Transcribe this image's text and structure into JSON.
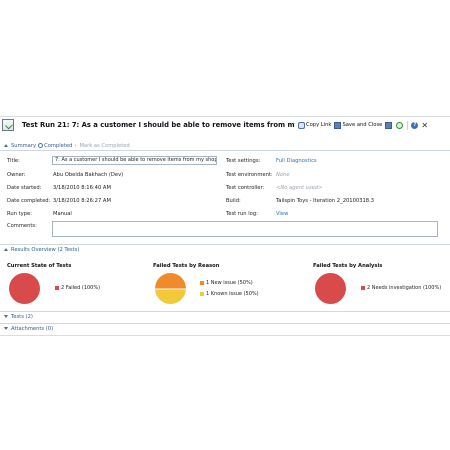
{
  "window": {
    "title": "Test Run 21: 7: As a customer I should be able to remove items from my shopping",
    "toolbar": {
      "copy_link": "Copy Link",
      "save_close": "Save and Close",
      "help": "?",
      "close": "✕"
    }
  },
  "summary_bar": {
    "summary": "Summary",
    "completed": "Completed",
    "mark_completed": "Mark as Completed"
  },
  "form": {
    "title_label": "Title:",
    "title_value": "7: As a customer I should be able to remove items from my shop",
    "owner_label": "Owner:",
    "owner_value": "Abu Obeida Bakhach (Dev)",
    "date_started_label": "Date started:",
    "date_started_value": "3/18/2010 8:16:40 AM",
    "date_completed_label": "Date completed:",
    "date_completed_value": "3/18/2010 8:26:27 AM",
    "run_type_label": "Run type:",
    "run_type_value": "Manual",
    "comments_label": "Comments:",
    "test_settings_label": "Test settings:",
    "test_settings_value": "Full Diagnostics",
    "test_environment_label": "Test environment:",
    "test_environment_value": "None",
    "test_controller_label": "Test controller:",
    "test_controller_value": "<No agent used>",
    "build_label": "Build:",
    "build_value": "Tailspin Toys - Iteration 2_20100318.3",
    "test_run_log_label": "Test run log:",
    "test_run_log_value": "View"
  },
  "results": {
    "header": "Results Overview (2 Tests)",
    "current_state_title": "Current State of Tests",
    "current_state_legend": "2 Failed (100%)",
    "by_reason_title": "Failed Tests by Reason",
    "by_reason_legend_1": "1 New issue (50%)",
    "by_reason_legend_2": "1 Known issue (50%)",
    "by_analysis_title": "Failed Tests by Analysis",
    "by_analysis_legend": "2 Needs investigation (100%)"
  },
  "sections": {
    "tests": "Tests (2)",
    "attachments": "Attachments (0)"
  },
  "chart_data": [
    {
      "type": "pie",
      "title": "Current State of Tests",
      "series": [
        {
          "name": "Failed",
          "values": [
            2
          ]
        }
      ],
      "categories": [
        "Failed"
      ],
      "colors": [
        "#d94a4a"
      ]
    },
    {
      "type": "pie",
      "title": "Failed Tests by Reason",
      "categories": [
        "New issue",
        "Known issue"
      ],
      "values": [
        1,
        1
      ],
      "colors": [
        "#f08a2a",
        "#f2c93a"
      ]
    },
    {
      "type": "pie",
      "title": "Failed Tests by Analysis",
      "categories": [
        "Needs investigation"
      ],
      "values": [
        2
      ],
      "colors": [
        "#d94a4a"
      ]
    }
  ]
}
